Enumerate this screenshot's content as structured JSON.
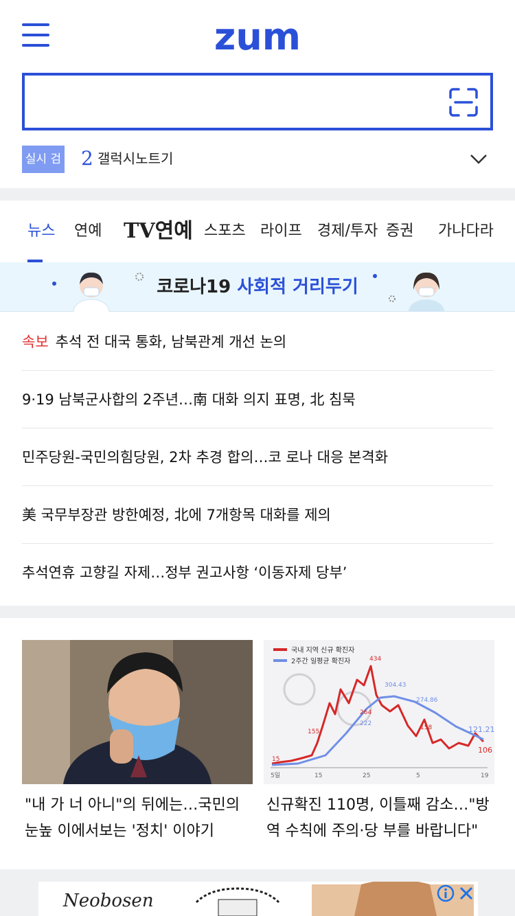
{
  "header": {
    "logo_text": "zum",
    "menu_icon": "hamburger-icon"
  },
  "search": {
    "value": "",
    "placeholder": "",
    "scan_icon": "scan-icon"
  },
  "trending": {
    "badge": "실시 검색어",
    "rank": "2",
    "keyword": "갤럭시노트기"
  },
  "tabs": [
    {
      "label": "뉴스",
      "active": true
    },
    {
      "label": "연예"
    },
    {
      "label": "TV연예"
    },
    {
      "label": "스포츠"
    },
    {
      "label": "라이프"
    },
    {
      "label": "경제/투자"
    },
    {
      "label": "증권"
    },
    {
      "label": "가나다라"
    }
  ],
  "banner": {
    "part1": "코로나19",
    "part2": "사회적 거리두기"
  },
  "news": {
    "items": [
      {
        "tag": "속보",
        "title": "추석 전 대국 통화, 남북관계 개선 논의"
      },
      {
        "title": "9·19 남북군사합의 2주년…南 대화 의지 표명, 北 침묵"
      },
      {
        "title": "민주당원-국민의힘당원, 2차 추경 합의…코 로나 대응 본격화"
      },
      {
        "title": "美 국무부장관 방한예정, 北에 7개항목 대화를 제의"
      },
      {
        "title": "추석연휴 고향길 자제…정부 권고사항 ‘이동자제 당부’"
      }
    ]
  },
  "cards": [
    {
      "title": "\"내 가 너 아니\"의 뒤에는…국민의 눈높 이에서보는 '정치' 이야기"
    },
    {
      "title": "신규확진 110명, 이틀째 감소…\"방역 수칙에 주의·당 부를 바랍니다\""
    }
  ],
  "chart_card": {
    "legend": [
      "국내 지역 신규 확진자",
      "2주간 일평균 확진자"
    ],
    "labels": [
      "15",
      "155",
      "264",
      "222",
      "434",
      "304.43",
      "274.86",
      "158",
      "121.21",
      "106"
    ],
    "xticks": [
      "5일",
      "15",
      "25",
      "5",
      "19"
    ],
    "colors": {
      "daily": "#d62828",
      "avg": "#6f8fe6"
    }
  },
  "ad": {
    "brand": "Neobosen"
  },
  "colors": {
    "accent": "#2b50d8",
    "badge": "#7f9cf2",
    "breaking": "#e03131"
  }
}
